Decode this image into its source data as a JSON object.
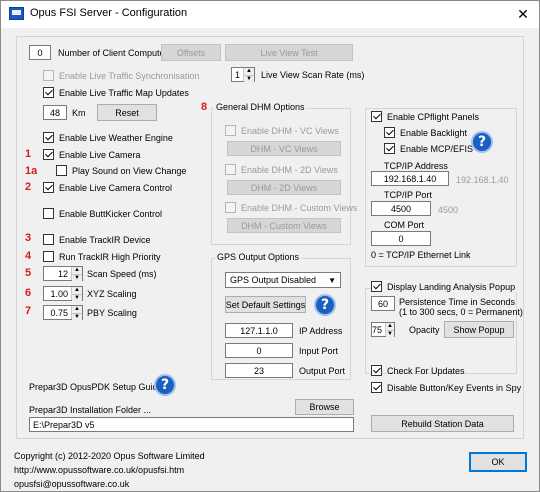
{
  "window": {
    "title": "Opus FSI Server - Configuration",
    "close": "✕"
  },
  "clients": {
    "count": "0",
    "label": "Number of Client Computers",
    "offsets": "Offsets",
    "live_view_test": "Live View Test"
  },
  "traffic": {
    "sync": "Enable Live Traffic Synchronisation",
    "map": "Enable Live Traffic Map Updates",
    "km_value": "48",
    "km_label": "Km",
    "reset": "Reset"
  },
  "scan_rate": {
    "value": "1",
    "label": "Live View Scan Rate (ms)"
  },
  "weather": "Enable Live Weather Engine",
  "camera": {
    "enable": "Enable Live Camera",
    "sound": "Play Sound on View Change",
    "control": "Enable Live Camera Control",
    "buttkicker": "Enable ButtKicker Control"
  },
  "trackir": {
    "enable": "Enable TrackIR Device",
    "priority": "Run TrackIR High Priority",
    "scan_value": "12",
    "scan_label": "Scan Speed (ms)",
    "xyz_value": "1.00",
    "xyz_label": "XYZ Scaling",
    "pby_value": "0.75",
    "pby_label": "PBY Scaling"
  },
  "markers": {
    "m1": "1",
    "m1a": "1a",
    "m2": "2",
    "m3": "3",
    "m4": "4",
    "m5": "5",
    "m6": "6",
    "m7": "7",
    "m8": "8"
  },
  "dhm": {
    "title": "General DHM Options",
    "vc_check": "Enable DHM - VC Views",
    "vc_btn": "DHM - VC Views",
    "d2_check": "Enable DHM - 2D Views",
    "d2_btn": "DHM - 2D Views",
    "custom_check": "Enable DHM - Custom Views",
    "custom_btn": "DHM - Custom Views"
  },
  "gps": {
    "title": "GPS Output Options",
    "select": "GPS Output Disabled",
    "defaults": "Set Default Settings",
    "ip_value": "127.1.1.0",
    "ip_label": "IP Address",
    "input_value": "0",
    "input_label": "Input Port",
    "output_value": "23",
    "output_label": "Output Port"
  },
  "cpflight": {
    "enable": "Enable CPflight Panels",
    "backlight": "Enable Backlight",
    "mcp": "Enable MCP/EFIS",
    "tcp_ip_label": "TCP/IP Address",
    "tcp_ip_value": "192.168.1.40",
    "tcp_ip_hint": "192.168.1.40",
    "tcp_port_label": "TCP/IP Port",
    "tcp_port_value": "4500",
    "tcp_port_hint": "4500",
    "com_label": "COM Port",
    "com_value": "0",
    "com_note": "0 = TCP/IP Ethernet Link"
  },
  "landing": {
    "enable": "Display Landing Analysis Popup",
    "persist_value": "60",
    "persist_label_1": "Persistence Time in Seconds",
    "persist_label_2": "(1 to 300 secs, 0 = Permanent)",
    "opacity_value": "75",
    "opacity_label": "Opacity",
    "show_popup": "Show Popup"
  },
  "updates": {
    "check": "Check For Updates",
    "disable_spy": "Disable Button/Key Events in Spy"
  },
  "prepar3d": {
    "pdk_guide": "Prepar3D OpusPDK Setup Guide",
    "folder_label": "Prepar3D Installation Folder ...",
    "browse": "Browse",
    "folder_value": "E:\\Prepar3D v5"
  },
  "rebuild": "Rebuild Station Data",
  "footer": {
    "copyright": "Copyright (c)  2012-2020 Opus Software Limited",
    "url": "http://www.opussoftware.co.uk/opusfsi.htm",
    "email": "opusfsi@opussoftware.co.uk",
    "ok": "OK"
  },
  "icons": {
    "help": "?"
  },
  "colors": {
    "marker": "#d81b1b",
    "help_blue": "#1b5fbf"
  }
}
